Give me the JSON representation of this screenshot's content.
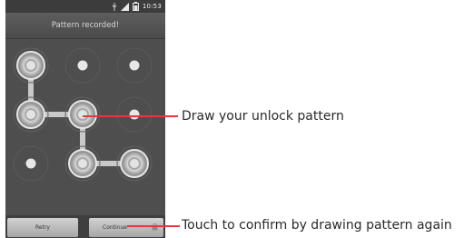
{
  "statusbar": {
    "time": "10:53",
    "icons": [
      "usb-icon",
      "signal-icon",
      "battery-icon"
    ]
  },
  "screen": {
    "title": "Pattern recorded!"
  },
  "buttons": {
    "retry": "Retry",
    "continue": "Continue"
  },
  "callouts": {
    "draw": "Draw your unlock pattern",
    "confirm": "Touch to confirm by drawing pattern again"
  },
  "pattern": {
    "path": [
      1,
      4,
      5,
      8,
      9
    ],
    "colors": {
      "line": "#c9c9c9",
      "accent": "#e0393e"
    }
  }
}
